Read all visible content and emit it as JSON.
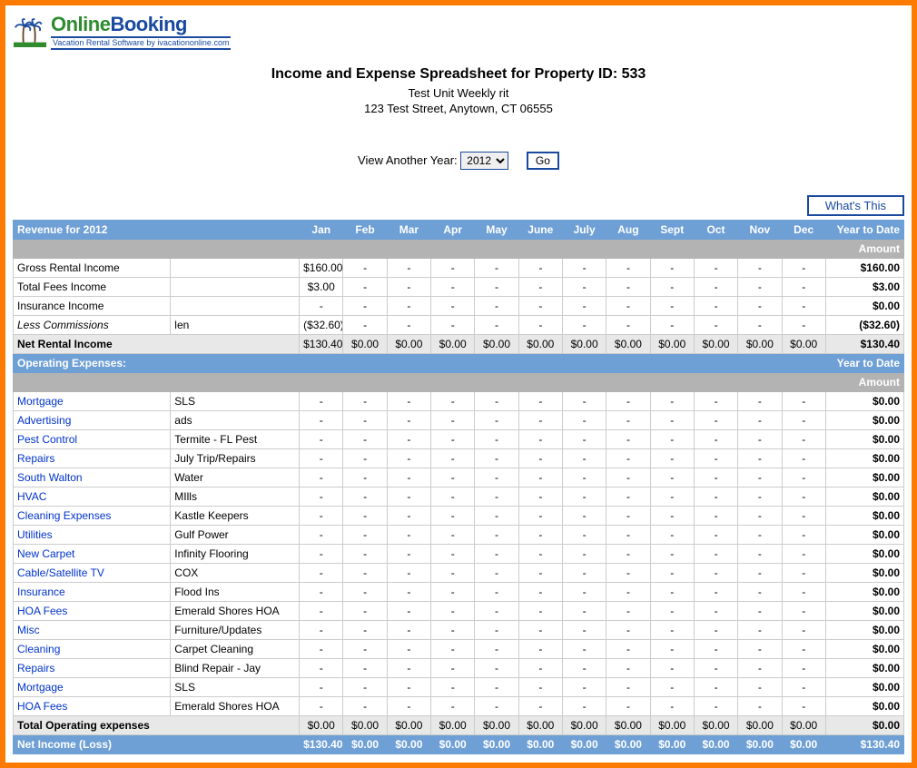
{
  "logo": {
    "online": "Online",
    "booking": "Booking",
    "tagline": "Vacation Rental Software by ivacationonline.com"
  },
  "header": {
    "title": "Income and Expense Spreadsheet for Property ID: 533",
    "unit": "Test Unit Weekly rit",
    "address": "123 Test Street, Anytown, CT 06555"
  },
  "year_select": {
    "label": "View Another Year:",
    "value": "2012",
    "go": "Go"
  },
  "whats_this": "What's This",
  "months": [
    "Jan",
    "Feb",
    "Mar",
    "Apr",
    "May",
    "June",
    "July",
    "Aug",
    "Sept",
    "Oct",
    "Nov",
    "Dec"
  ],
  "ytd_label": "Year to Date",
  "amount_label": "Amount",
  "revenue": {
    "header": "Revenue for 2012",
    "rows": [
      {
        "label": "Gross Rental Income",
        "desc": "",
        "values": [
          "$160.00",
          "-",
          "-",
          "-",
          "-",
          "-",
          "-",
          "-",
          "-",
          "-",
          "-",
          "-"
        ],
        "ytd": "$160.00",
        "link": false
      },
      {
        "label": "Total Fees Income",
        "desc": "",
        "values": [
          "$3.00",
          "-",
          "-",
          "-",
          "-",
          "-",
          "-",
          "-",
          "-",
          "-",
          "-",
          "-"
        ],
        "ytd": "$3.00",
        "link": false
      },
      {
        "label": "Insurance Income",
        "desc": "",
        "values": [
          "-",
          "-",
          "-",
          "-",
          "-",
          "-",
          "-",
          "-",
          "-",
          "-",
          "-",
          "-"
        ],
        "ytd": "$0.00",
        "link": false
      },
      {
        "label": "Less Commissions",
        "desc": "len",
        "values": [
          "($32.60)",
          "-",
          "-",
          "-",
          "-",
          "-",
          "-",
          "-",
          "-",
          "-",
          "-",
          "-"
        ],
        "ytd": "($32.60)",
        "link": false,
        "italic": true
      }
    ],
    "net": {
      "label": "Net Rental Income",
      "values": [
        "$130.40",
        "$0.00",
        "$0.00",
        "$0.00",
        "$0.00",
        "$0.00",
        "$0.00",
        "$0.00",
        "$0.00",
        "$0.00",
        "$0.00",
        "$0.00"
      ],
      "ytd": "$130.40"
    }
  },
  "expenses": {
    "header": "Operating Expenses:",
    "rows": [
      {
        "label": "Mortgage",
        "desc": "SLS",
        "values": [
          "-",
          "-",
          "-",
          "-",
          "-",
          "-",
          "-",
          "-",
          "-",
          "-",
          "-",
          "-"
        ],
        "ytd": "$0.00",
        "link": true
      },
      {
        "label": "Advertising",
        "desc": "ads",
        "values": [
          "-",
          "-",
          "-",
          "-",
          "-",
          "-",
          "-",
          "-",
          "-",
          "-",
          "-",
          "-"
        ],
        "ytd": "$0.00",
        "link": true
      },
      {
        "label": "Pest Control",
        "desc": "Termite - FL Pest",
        "values": [
          "-",
          "-",
          "-",
          "-",
          "-",
          "-",
          "-",
          "-",
          "-",
          "-",
          "-",
          "-"
        ],
        "ytd": "$0.00",
        "link": true
      },
      {
        "label": "Repairs",
        "desc": "July Trip/Repairs",
        "values": [
          "-",
          "-",
          "-",
          "-",
          "-",
          "-",
          "-",
          "-",
          "-",
          "-",
          "-",
          "-"
        ],
        "ytd": "$0.00",
        "link": true
      },
      {
        "label": "South Walton",
        "desc": "Water",
        "values": [
          "-",
          "-",
          "-",
          "-",
          "-",
          "-",
          "-",
          "-",
          "-",
          "-",
          "-",
          "-"
        ],
        "ytd": "$0.00",
        "link": true
      },
      {
        "label": "HVAC",
        "desc": "MIlls",
        "values": [
          "-",
          "-",
          "-",
          "-",
          "-",
          "-",
          "-",
          "-",
          "-",
          "-",
          "-",
          "-"
        ],
        "ytd": "$0.00",
        "link": true
      },
      {
        "label": "Cleaning Expenses",
        "desc": "Kastle Keepers",
        "values": [
          "-",
          "-",
          "-",
          "-",
          "-",
          "-",
          "-",
          "-",
          "-",
          "-",
          "-",
          "-"
        ],
        "ytd": "$0.00",
        "link": true
      },
      {
        "label": "Utilities",
        "desc": "Gulf Power",
        "values": [
          "-",
          "-",
          "-",
          "-",
          "-",
          "-",
          "-",
          "-",
          "-",
          "-",
          "-",
          "-"
        ],
        "ytd": "$0.00",
        "link": true
      },
      {
        "label": "New Carpet",
        "desc": "Infinity Flooring",
        "values": [
          "-",
          "-",
          "-",
          "-",
          "-",
          "-",
          "-",
          "-",
          "-",
          "-",
          "-",
          "-"
        ],
        "ytd": "$0.00",
        "link": true
      },
      {
        "label": "Cable/Satellite TV",
        "desc": "COX",
        "values": [
          "-",
          "-",
          "-",
          "-",
          "-",
          "-",
          "-",
          "-",
          "-",
          "-",
          "-",
          "-"
        ],
        "ytd": "$0.00",
        "link": true
      },
      {
        "label": "Insurance",
        "desc": "Flood Ins",
        "values": [
          "-",
          "-",
          "-",
          "-",
          "-",
          "-",
          "-",
          "-",
          "-",
          "-",
          "-",
          "-"
        ],
        "ytd": "$0.00",
        "link": true
      },
      {
        "label": "HOA Fees",
        "desc": "Emerald Shores HOA",
        "values": [
          "-",
          "-",
          "-",
          "-",
          "-",
          "-",
          "-",
          "-",
          "-",
          "-",
          "-",
          "-"
        ],
        "ytd": "$0.00",
        "link": true
      },
      {
        "label": "Misc",
        "desc": "Furniture/Updates",
        "values": [
          "-",
          "-",
          "-",
          "-",
          "-",
          "-",
          "-",
          "-",
          "-",
          "-",
          "-",
          "-"
        ],
        "ytd": "$0.00",
        "link": true
      },
      {
        "label": "Cleaning",
        "desc": "Carpet Cleaning",
        "values": [
          "-",
          "-",
          "-",
          "-",
          "-",
          "-",
          "-",
          "-",
          "-",
          "-",
          "-",
          "-"
        ],
        "ytd": "$0.00",
        "link": true
      },
      {
        "label": "Repairs",
        "desc": "Blind Repair - Jay",
        "values": [
          "-",
          "-",
          "-",
          "-",
          "-",
          "-",
          "-",
          "-",
          "-",
          "-",
          "-",
          "-"
        ],
        "ytd": "$0.00",
        "link": true
      },
      {
        "label": "Mortgage",
        "desc": "SLS",
        "values": [
          "-",
          "-",
          "-",
          "-",
          "-",
          "-",
          "-",
          "-",
          "-",
          "-",
          "-",
          "-"
        ],
        "ytd": "$0.00",
        "link": true
      },
      {
        "label": "HOA Fees",
        "desc": "Emerald Shores HOA",
        "values": [
          "-",
          "-",
          "-",
          "-",
          "-",
          "-",
          "-",
          "-",
          "-",
          "-",
          "-",
          "-"
        ],
        "ytd": "$0.00",
        "link": true
      }
    ],
    "total": {
      "label": "Total Operating expenses",
      "values": [
        "$0.00",
        "$0.00",
        "$0.00",
        "$0.00",
        "$0.00",
        "$0.00",
        "$0.00",
        "$0.00",
        "$0.00",
        "$0.00",
        "$0.00",
        "$0.00"
      ],
      "ytd": "$0.00"
    }
  },
  "grand": {
    "label": "Net Income (Loss)",
    "values": [
      "$130.40",
      "$0.00",
      "$0.00",
      "$0.00",
      "$0.00",
      "$0.00",
      "$0.00",
      "$0.00",
      "$0.00",
      "$0.00",
      "$0.00",
      "$0.00"
    ],
    "ytd": "$130.40"
  }
}
